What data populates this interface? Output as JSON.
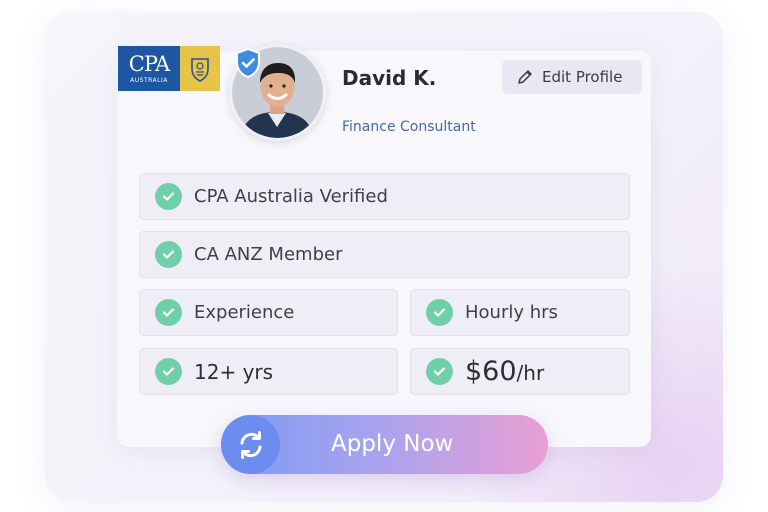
{
  "brand": {
    "logo_text": "CPA",
    "logo_subtext": "AUSTRALIA"
  },
  "profile": {
    "name": "David K.",
    "role": "Finance Consultant",
    "edit_label": "Edit Profile"
  },
  "credentials": [
    {
      "label": "CPA Australia Verified"
    },
    {
      "label": "CA ANZ Member"
    }
  ],
  "stats": {
    "experience_label": "Experience",
    "experience_value": "12+ yrs",
    "rate_label": "Hourly",
    "rate_label_suffix": "hrs",
    "rate_value": "$60",
    "rate_unit": "/hr"
  },
  "cta": {
    "apply_label": "Apply Now"
  },
  "colors": {
    "check_green": "#6fcfa9",
    "logo_blue": "#1d56a2",
    "logo_gold": "#e7c349",
    "accent_blue": "#4a68a8",
    "cta_start": "#7c9af2",
    "cta_end": "#e99fd4"
  }
}
